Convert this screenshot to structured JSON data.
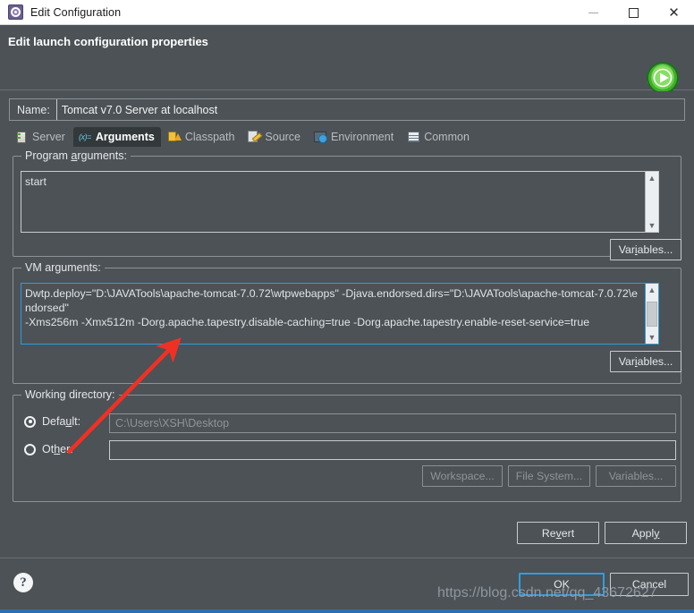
{
  "window": {
    "title": "Edit Configuration",
    "icon": "configuration-gear-icon",
    "controls": {
      "minimize": "—",
      "maximize": "□",
      "close": "✕"
    }
  },
  "banner": {
    "title": "Edit launch configuration properties",
    "badge_icon": "run-play-icon"
  },
  "name_row": {
    "label": "Name:",
    "value": "Tomcat v7.0 Server at localhost"
  },
  "tabs": [
    {
      "label": "Server",
      "icon": "server-icon",
      "active": false
    },
    {
      "label": "Arguments",
      "icon": "arguments-icon",
      "active": true
    },
    {
      "label": "Classpath",
      "icon": "classpath-icon",
      "active": false
    },
    {
      "label": "Source",
      "icon": "source-icon",
      "active": false
    },
    {
      "label": "Environment",
      "icon": "environment-icon",
      "active": false
    },
    {
      "label": "Common",
      "icon": "common-icon",
      "active": false
    }
  ],
  "program_arguments": {
    "legend_before": "Program ",
    "legend_mnemonic": "a",
    "legend_after": "rguments:",
    "value": "start",
    "variables_button": {
      "before": "Var",
      "mnemonic": "i",
      "after": "ables..."
    }
  },
  "vm_arguments": {
    "legend_before": "VM ar",
    "legend_mnemonic": "g",
    "legend_after": "uments:",
    "line1": "Dwtp.deploy=\"D:\\JAVATools\\apache-tomcat-7.0.72\\wtpwebapps\" -Djava.endorsed.dirs=\"D:\\JAVATools\\apache-tomcat-7.0.72\\endorsed\"",
    "line2": "-Xms256m -Xmx512m -Dorg.apache.tapestry.disable-caching=true -Dorg.apache.tapestry.enable-reset-service=true",
    "variables_button": {
      "before": "Var",
      "mnemonic": "i",
      "after": "ables..."
    }
  },
  "working_directory": {
    "legend": "Working directory:",
    "default": {
      "before": "Defa",
      "mnemonic": "u",
      "after": "lt:",
      "selected": true,
      "value": "C:\\Users\\XSH\\Desktop"
    },
    "other": {
      "before": "Ot",
      "mnemonic": "h",
      "after": "er:",
      "selected": false,
      "value": ""
    },
    "buttons": [
      {
        "label": "Workspace...",
        "enabled": false
      },
      {
        "label": "File System...",
        "enabled": false
      },
      {
        "label": "Variables...",
        "enabled": false
      }
    ]
  },
  "action_buttons": {
    "revert": {
      "before": "Re",
      "mnemonic": "v",
      "after": "ert"
    },
    "apply": {
      "before": "Appl",
      "mnemonic": "y",
      "after": ""
    }
  },
  "dialog_buttons": {
    "ok": "OK",
    "cancel": "Cancel"
  },
  "help": {
    "icon": "help-question-icon",
    "glyph": "?"
  },
  "watermark": "https://blog.csdn.net/qq_43672627",
  "colors": {
    "background": "#4c5256",
    "focus_blue": "#2f9de0",
    "text": "#e6e8ea",
    "disabled_text": "#8f9498",
    "annotation_red": "#ef3124",
    "bottom_strip": "#2b6fb0"
  }
}
